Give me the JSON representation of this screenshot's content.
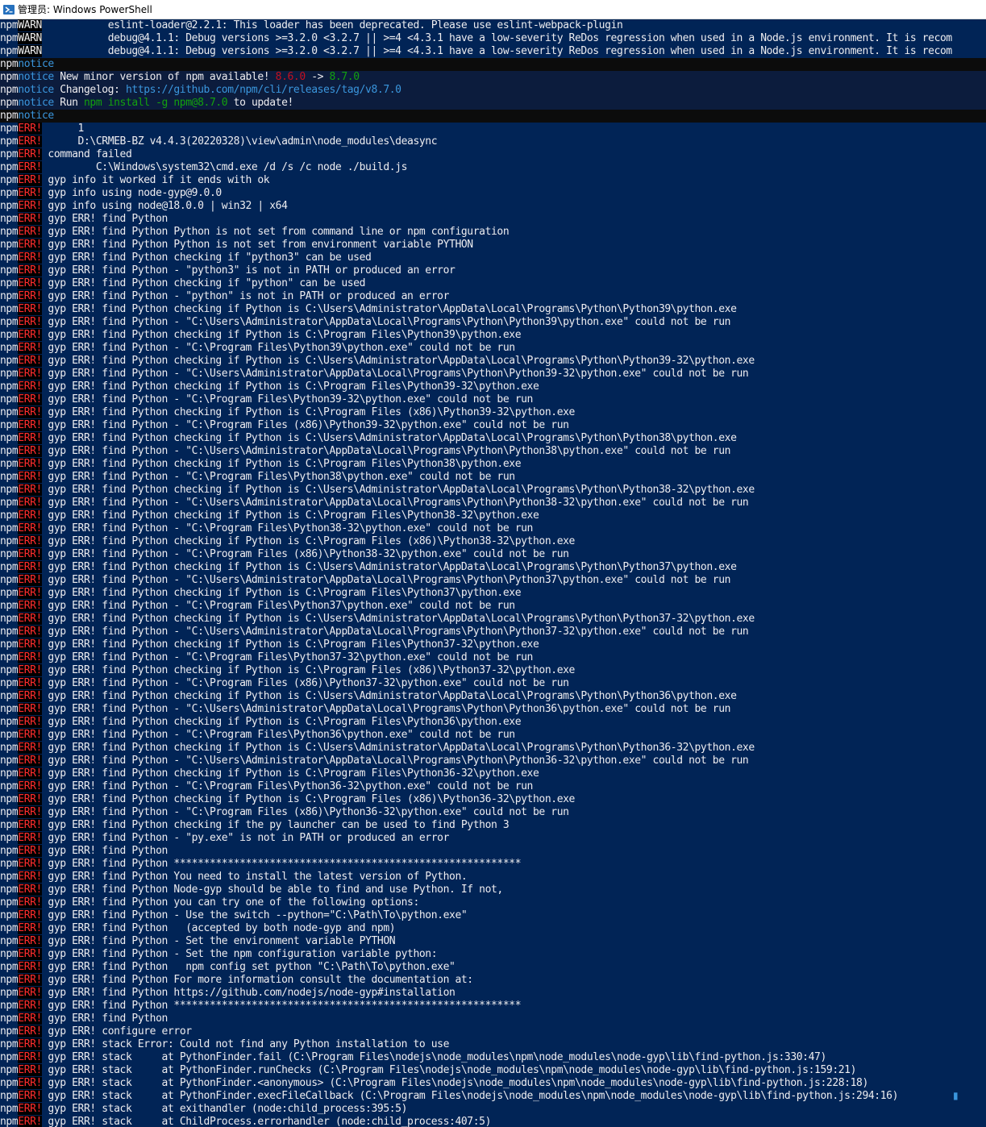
{
  "window": {
    "title": "管理员: Windows PowerShell",
    "icon": "powershell-icon"
  },
  "colors": {
    "background": "#012456",
    "err": "#ff2d2d",
    "notice": "#3a96dd",
    "version_old": "#c50f1f",
    "version_new": "#13a10e"
  },
  "lines": [
    {
      "p": "npm",
      "l": "WARN",
      "t": "           eslint-loader@2.2.1: This loader has been deprecated. Please use eslint-webpack-plugin"
    },
    {
      "p": "npm",
      "l": "WARN",
      "t": "           debug@4.1.1: Debug versions >=3.2.0 <3.2.7 || >=4 <4.3.1 have a low-severity ReDos regression when used in a Node.js environment. It is recom"
    },
    {
      "p": "npm",
      "l": "WARN",
      "t": "           debug@4.1.1: Debug versions >=3.2.0 <3.2.7 || >=4 <4.3.1 have a low-severity ReDos regression when used in a Node.js environment. It is recom"
    },
    {
      "p": "npm",
      "l": "notice",
      "t": "",
      "kind": "notice-empty"
    },
    {
      "p": "npm",
      "l": "notice",
      "t": " New minor version of npm available! ",
      "v1": "8.6.0",
      "mid": " -> ",
      "v2": "8.7.0",
      "kind": "notice-block"
    },
    {
      "p": "npm",
      "l": "notice",
      "t": " Changelog: ",
      "link": "https://github.com/npm/cli/releases/tag/v8.7.0",
      "kind": "notice-block"
    },
    {
      "p": "npm",
      "l": "notice",
      "t": " Run ",
      "cmd": "npm install -g npm@8.7.0",
      "tail": " to update!",
      "kind": "notice-block"
    },
    {
      "p": "npm",
      "l": "notice",
      "t": "",
      "kind": "notice-empty"
    },
    {
      "p": "npm",
      "l": "ERR!",
      "t": "      1"
    },
    {
      "p": "npm",
      "l": "ERR!",
      "t": "      D:\\CRMEB-BZ v4.4.3(20220328)\\view\\admin\\node_modules\\deasync"
    },
    {
      "p": "npm",
      "l": "ERR!",
      "t": " command failed"
    },
    {
      "p": "npm",
      "l": "ERR!",
      "t": "         C:\\Windows\\system32\\cmd.exe /d /s /c node ./build.js"
    },
    {
      "p": "npm",
      "l": "ERR!",
      "t": " gyp info it worked if it ends with ok"
    },
    {
      "p": "npm",
      "l": "ERR!",
      "t": " gyp info using node-gyp@9.0.0"
    },
    {
      "p": "npm",
      "l": "ERR!",
      "t": " gyp info using node@18.0.0 | win32 | x64"
    },
    {
      "p": "npm",
      "l": "ERR!",
      "t": " gyp ERR! find Python"
    },
    {
      "p": "npm",
      "l": "ERR!",
      "t": " gyp ERR! find Python Python is not set from command line or npm configuration"
    },
    {
      "p": "npm",
      "l": "ERR!",
      "t": " gyp ERR! find Python Python is not set from environment variable PYTHON"
    },
    {
      "p": "npm",
      "l": "ERR!",
      "t": " gyp ERR! find Python checking if \"python3\" can be used"
    },
    {
      "p": "npm",
      "l": "ERR!",
      "t": " gyp ERR! find Python - \"python3\" is not in PATH or produced an error"
    },
    {
      "p": "npm",
      "l": "ERR!",
      "t": " gyp ERR! find Python checking if \"python\" can be used"
    },
    {
      "p": "npm",
      "l": "ERR!",
      "t": " gyp ERR! find Python - \"python\" is not in PATH or produced an error"
    },
    {
      "p": "npm",
      "l": "ERR!",
      "t": " gyp ERR! find Python checking if Python is C:\\Users\\Administrator\\AppData\\Local\\Programs\\Python\\Python39\\python.exe"
    },
    {
      "p": "npm",
      "l": "ERR!",
      "t": " gyp ERR! find Python - \"C:\\Users\\Administrator\\AppData\\Local\\Programs\\Python\\Python39\\python.exe\" could not be run"
    },
    {
      "p": "npm",
      "l": "ERR!",
      "t": " gyp ERR! find Python checking if Python is C:\\Program Files\\Python39\\python.exe"
    },
    {
      "p": "npm",
      "l": "ERR!",
      "t": " gyp ERR! find Python - \"C:\\Program Files\\Python39\\python.exe\" could not be run"
    },
    {
      "p": "npm",
      "l": "ERR!",
      "t": " gyp ERR! find Python checking if Python is C:\\Users\\Administrator\\AppData\\Local\\Programs\\Python\\Python39-32\\python.exe"
    },
    {
      "p": "npm",
      "l": "ERR!",
      "t": " gyp ERR! find Python - \"C:\\Users\\Administrator\\AppData\\Local\\Programs\\Python\\Python39-32\\python.exe\" could not be run"
    },
    {
      "p": "npm",
      "l": "ERR!",
      "t": " gyp ERR! find Python checking if Python is C:\\Program Files\\Python39-32\\python.exe"
    },
    {
      "p": "npm",
      "l": "ERR!",
      "t": " gyp ERR! find Python - \"C:\\Program Files\\Python39-32\\python.exe\" could not be run"
    },
    {
      "p": "npm",
      "l": "ERR!",
      "t": " gyp ERR! find Python checking if Python is C:\\Program Files (x86)\\Python39-32\\python.exe"
    },
    {
      "p": "npm",
      "l": "ERR!",
      "t": " gyp ERR! find Python - \"C:\\Program Files (x86)\\Python39-32\\python.exe\" could not be run"
    },
    {
      "p": "npm",
      "l": "ERR!",
      "t": " gyp ERR! find Python checking if Python is C:\\Users\\Administrator\\AppData\\Local\\Programs\\Python\\Python38\\python.exe"
    },
    {
      "p": "npm",
      "l": "ERR!",
      "t": " gyp ERR! find Python - \"C:\\Users\\Administrator\\AppData\\Local\\Programs\\Python\\Python38\\python.exe\" could not be run"
    },
    {
      "p": "npm",
      "l": "ERR!",
      "t": " gyp ERR! find Python checking if Python is C:\\Program Files\\Python38\\python.exe"
    },
    {
      "p": "npm",
      "l": "ERR!",
      "t": " gyp ERR! find Python - \"C:\\Program Files\\Python38\\python.exe\" could not be run"
    },
    {
      "p": "npm",
      "l": "ERR!",
      "t": " gyp ERR! find Python checking if Python is C:\\Users\\Administrator\\AppData\\Local\\Programs\\Python\\Python38-32\\python.exe"
    },
    {
      "p": "npm",
      "l": "ERR!",
      "t": " gyp ERR! find Python - \"C:\\Users\\Administrator\\AppData\\Local\\Programs\\Python\\Python38-32\\python.exe\" could not be run"
    },
    {
      "p": "npm",
      "l": "ERR!",
      "t": " gyp ERR! find Python checking if Python is C:\\Program Files\\Python38-32\\python.exe"
    },
    {
      "p": "npm",
      "l": "ERR!",
      "t": " gyp ERR! find Python - \"C:\\Program Files\\Python38-32\\python.exe\" could not be run"
    },
    {
      "p": "npm",
      "l": "ERR!",
      "t": " gyp ERR! find Python checking if Python is C:\\Program Files (x86)\\Python38-32\\python.exe"
    },
    {
      "p": "npm",
      "l": "ERR!",
      "t": " gyp ERR! find Python - \"C:\\Program Files (x86)\\Python38-32\\python.exe\" could not be run"
    },
    {
      "p": "npm",
      "l": "ERR!",
      "t": " gyp ERR! find Python checking if Python is C:\\Users\\Administrator\\AppData\\Local\\Programs\\Python\\Python37\\python.exe"
    },
    {
      "p": "npm",
      "l": "ERR!",
      "t": " gyp ERR! find Python - \"C:\\Users\\Administrator\\AppData\\Local\\Programs\\Python\\Python37\\python.exe\" could not be run"
    },
    {
      "p": "npm",
      "l": "ERR!",
      "t": " gyp ERR! find Python checking if Python is C:\\Program Files\\Python37\\python.exe"
    },
    {
      "p": "npm",
      "l": "ERR!",
      "t": " gyp ERR! find Python - \"C:\\Program Files\\Python37\\python.exe\" could not be run"
    },
    {
      "p": "npm",
      "l": "ERR!",
      "t": " gyp ERR! find Python checking if Python is C:\\Users\\Administrator\\AppData\\Local\\Programs\\Python\\Python37-32\\python.exe"
    },
    {
      "p": "npm",
      "l": "ERR!",
      "t": " gyp ERR! find Python - \"C:\\Users\\Administrator\\AppData\\Local\\Programs\\Python\\Python37-32\\python.exe\" could not be run"
    },
    {
      "p": "npm",
      "l": "ERR!",
      "t": " gyp ERR! find Python checking if Python is C:\\Program Files\\Python37-32\\python.exe"
    },
    {
      "p": "npm",
      "l": "ERR!",
      "t": " gyp ERR! find Python - \"C:\\Program Files\\Python37-32\\python.exe\" could not be run"
    },
    {
      "p": "npm",
      "l": "ERR!",
      "t": " gyp ERR! find Python checking if Python is C:\\Program Files (x86)\\Python37-32\\python.exe"
    },
    {
      "p": "npm",
      "l": "ERR!",
      "t": " gyp ERR! find Python - \"C:\\Program Files (x86)\\Python37-32\\python.exe\" could not be run"
    },
    {
      "p": "npm",
      "l": "ERR!",
      "t": " gyp ERR! find Python checking if Python is C:\\Users\\Administrator\\AppData\\Local\\Programs\\Python\\Python36\\python.exe"
    },
    {
      "p": "npm",
      "l": "ERR!",
      "t": " gyp ERR! find Python - \"C:\\Users\\Administrator\\AppData\\Local\\Programs\\Python\\Python36\\python.exe\" could not be run"
    },
    {
      "p": "npm",
      "l": "ERR!",
      "t": " gyp ERR! find Python checking if Python is C:\\Program Files\\Python36\\python.exe"
    },
    {
      "p": "npm",
      "l": "ERR!",
      "t": " gyp ERR! find Python - \"C:\\Program Files\\Python36\\python.exe\" could not be run"
    },
    {
      "p": "npm",
      "l": "ERR!",
      "t": " gyp ERR! find Python checking if Python is C:\\Users\\Administrator\\AppData\\Local\\Programs\\Python\\Python36-32\\python.exe"
    },
    {
      "p": "npm",
      "l": "ERR!",
      "t": " gyp ERR! find Python - \"C:\\Users\\Administrator\\AppData\\Local\\Programs\\Python\\Python36-32\\python.exe\" could not be run"
    },
    {
      "p": "npm",
      "l": "ERR!",
      "t": " gyp ERR! find Python checking if Python is C:\\Program Files\\Python36-32\\python.exe"
    },
    {
      "p": "npm",
      "l": "ERR!",
      "t": " gyp ERR! find Python - \"C:\\Program Files\\Python36-32\\python.exe\" could not be run"
    },
    {
      "p": "npm",
      "l": "ERR!",
      "t": " gyp ERR! find Python checking if Python is C:\\Program Files (x86)\\Python36-32\\python.exe"
    },
    {
      "p": "npm",
      "l": "ERR!",
      "t": " gyp ERR! find Python - \"C:\\Program Files (x86)\\Python36-32\\python.exe\" could not be run"
    },
    {
      "p": "npm",
      "l": "ERR!",
      "t": " gyp ERR! find Python checking if the py launcher can be used to find Python 3"
    },
    {
      "p": "npm",
      "l": "ERR!",
      "t": " gyp ERR! find Python - \"py.exe\" is not in PATH or produced an error"
    },
    {
      "p": "npm",
      "l": "ERR!",
      "t": " gyp ERR! find Python"
    },
    {
      "p": "npm",
      "l": "ERR!",
      "t": " gyp ERR! find Python **********************************************************"
    },
    {
      "p": "npm",
      "l": "ERR!",
      "t": " gyp ERR! find Python You need to install the latest version of Python."
    },
    {
      "p": "npm",
      "l": "ERR!",
      "t": " gyp ERR! find Python Node-gyp should be able to find and use Python. If not,"
    },
    {
      "p": "npm",
      "l": "ERR!",
      "t": " gyp ERR! find Python you can try one of the following options:"
    },
    {
      "p": "npm",
      "l": "ERR!",
      "t": " gyp ERR! find Python - Use the switch --python=\"C:\\Path\\To\\python.exe\""
    },
    {
      "p": "npm",
      "l": "ERR!",
      "t": " gyp ERR! find Python   (accepted by both node-gyp and npm)"
    },
    {
      "p": "npm",
      "l": "ERR!",
      "t": " gyp ERR! find Python - Set the environment variable PYTHON"
    },
    {
      "p": "npm",
      "l": "ERR!",
      "t": " gyp ERR! find Python - Set the npm configuration variable python:"
    },
    {
      "p": "npm",
      "l": "ERR!",
      "t": " gyp ERR! find Python   npm config set python \"C:\\Path\\To\\python.exe\""
    },
    {
      "p": "npm",
      "l": "ERR!",
      "t": " gyp ERR! find Python For more information consult the documentation at:"
    },
    {
      "p": "npm",
      "l": "ERR!",
      "t": " gyp ERR! find Python https://github.com/nodejs/node-gyp#installation"
    },
    {
      "p": "npm",
      "l": "ERR!",
      "t": " gyp ERR! find Python **********************************************************"
    },
    {
      "p": "npm",
      "l": "ERR!",
      "t": " gyp ERR! find Python"
    },
    {
      "p": "npm",
      "l": "ERR!",
      "t": " gyp ERR! configure error"
    },
    {
      "p": "npm",
      "l": "ERR!",
      "t": " gyp ERR! stack Error: Could not find any Python installation to use"
    },
    {
      "p": "npm",
      "l": "ERR!",
      "t": " gyp ERR! stack     at PythonFinder.fail (C:\\Program Files\\nodejs\\node_modules\\npm\\node_modules\\node-gyp\\lib\\find-python.js:330:47)"
    },
    {
      "p": "npm",
      "l": "ERR!",
      "t": " gyp ERR! stack     at PythonFinder.runChecks (C:\\Program Files\\nodejs\\node_modules\\npm\\node_modules\\node-gyp\\lib\\find-python.js:159:21)"
    },
    {
      "p": "npm",
      "l": "ERR!",
      "t": " gyp ERR! stack     at PythonFinder.<anonymous> (C:\\Program Files\\nodejs\\node_modules\\npm\\node_modules\\node-gyp\\lib\\find-python.js:228:18)"
    },
    {
      "p": "npm",
      "l": "ERR!",
      "t": " gyp ERR! stack     at PythonFinder.execFileCallback (C:\\Program Files\\nodejs\\node_modules\\npm\\node_modules\\node-gyp\\lib\\find-python.js:294:16)"
    },
    {
      "p": "npm",
      "l": "ERR!",
      "t": " gyp ERR! stack     at exithandler (node:child_process:395:5)"
    },
    {
      "p": "npm",
      "l": "ERR!",
      "t": " gyp ERR! stack     at ChildProcess.errorhandler (node:child_process:407:5)"
    }
  ]
}
